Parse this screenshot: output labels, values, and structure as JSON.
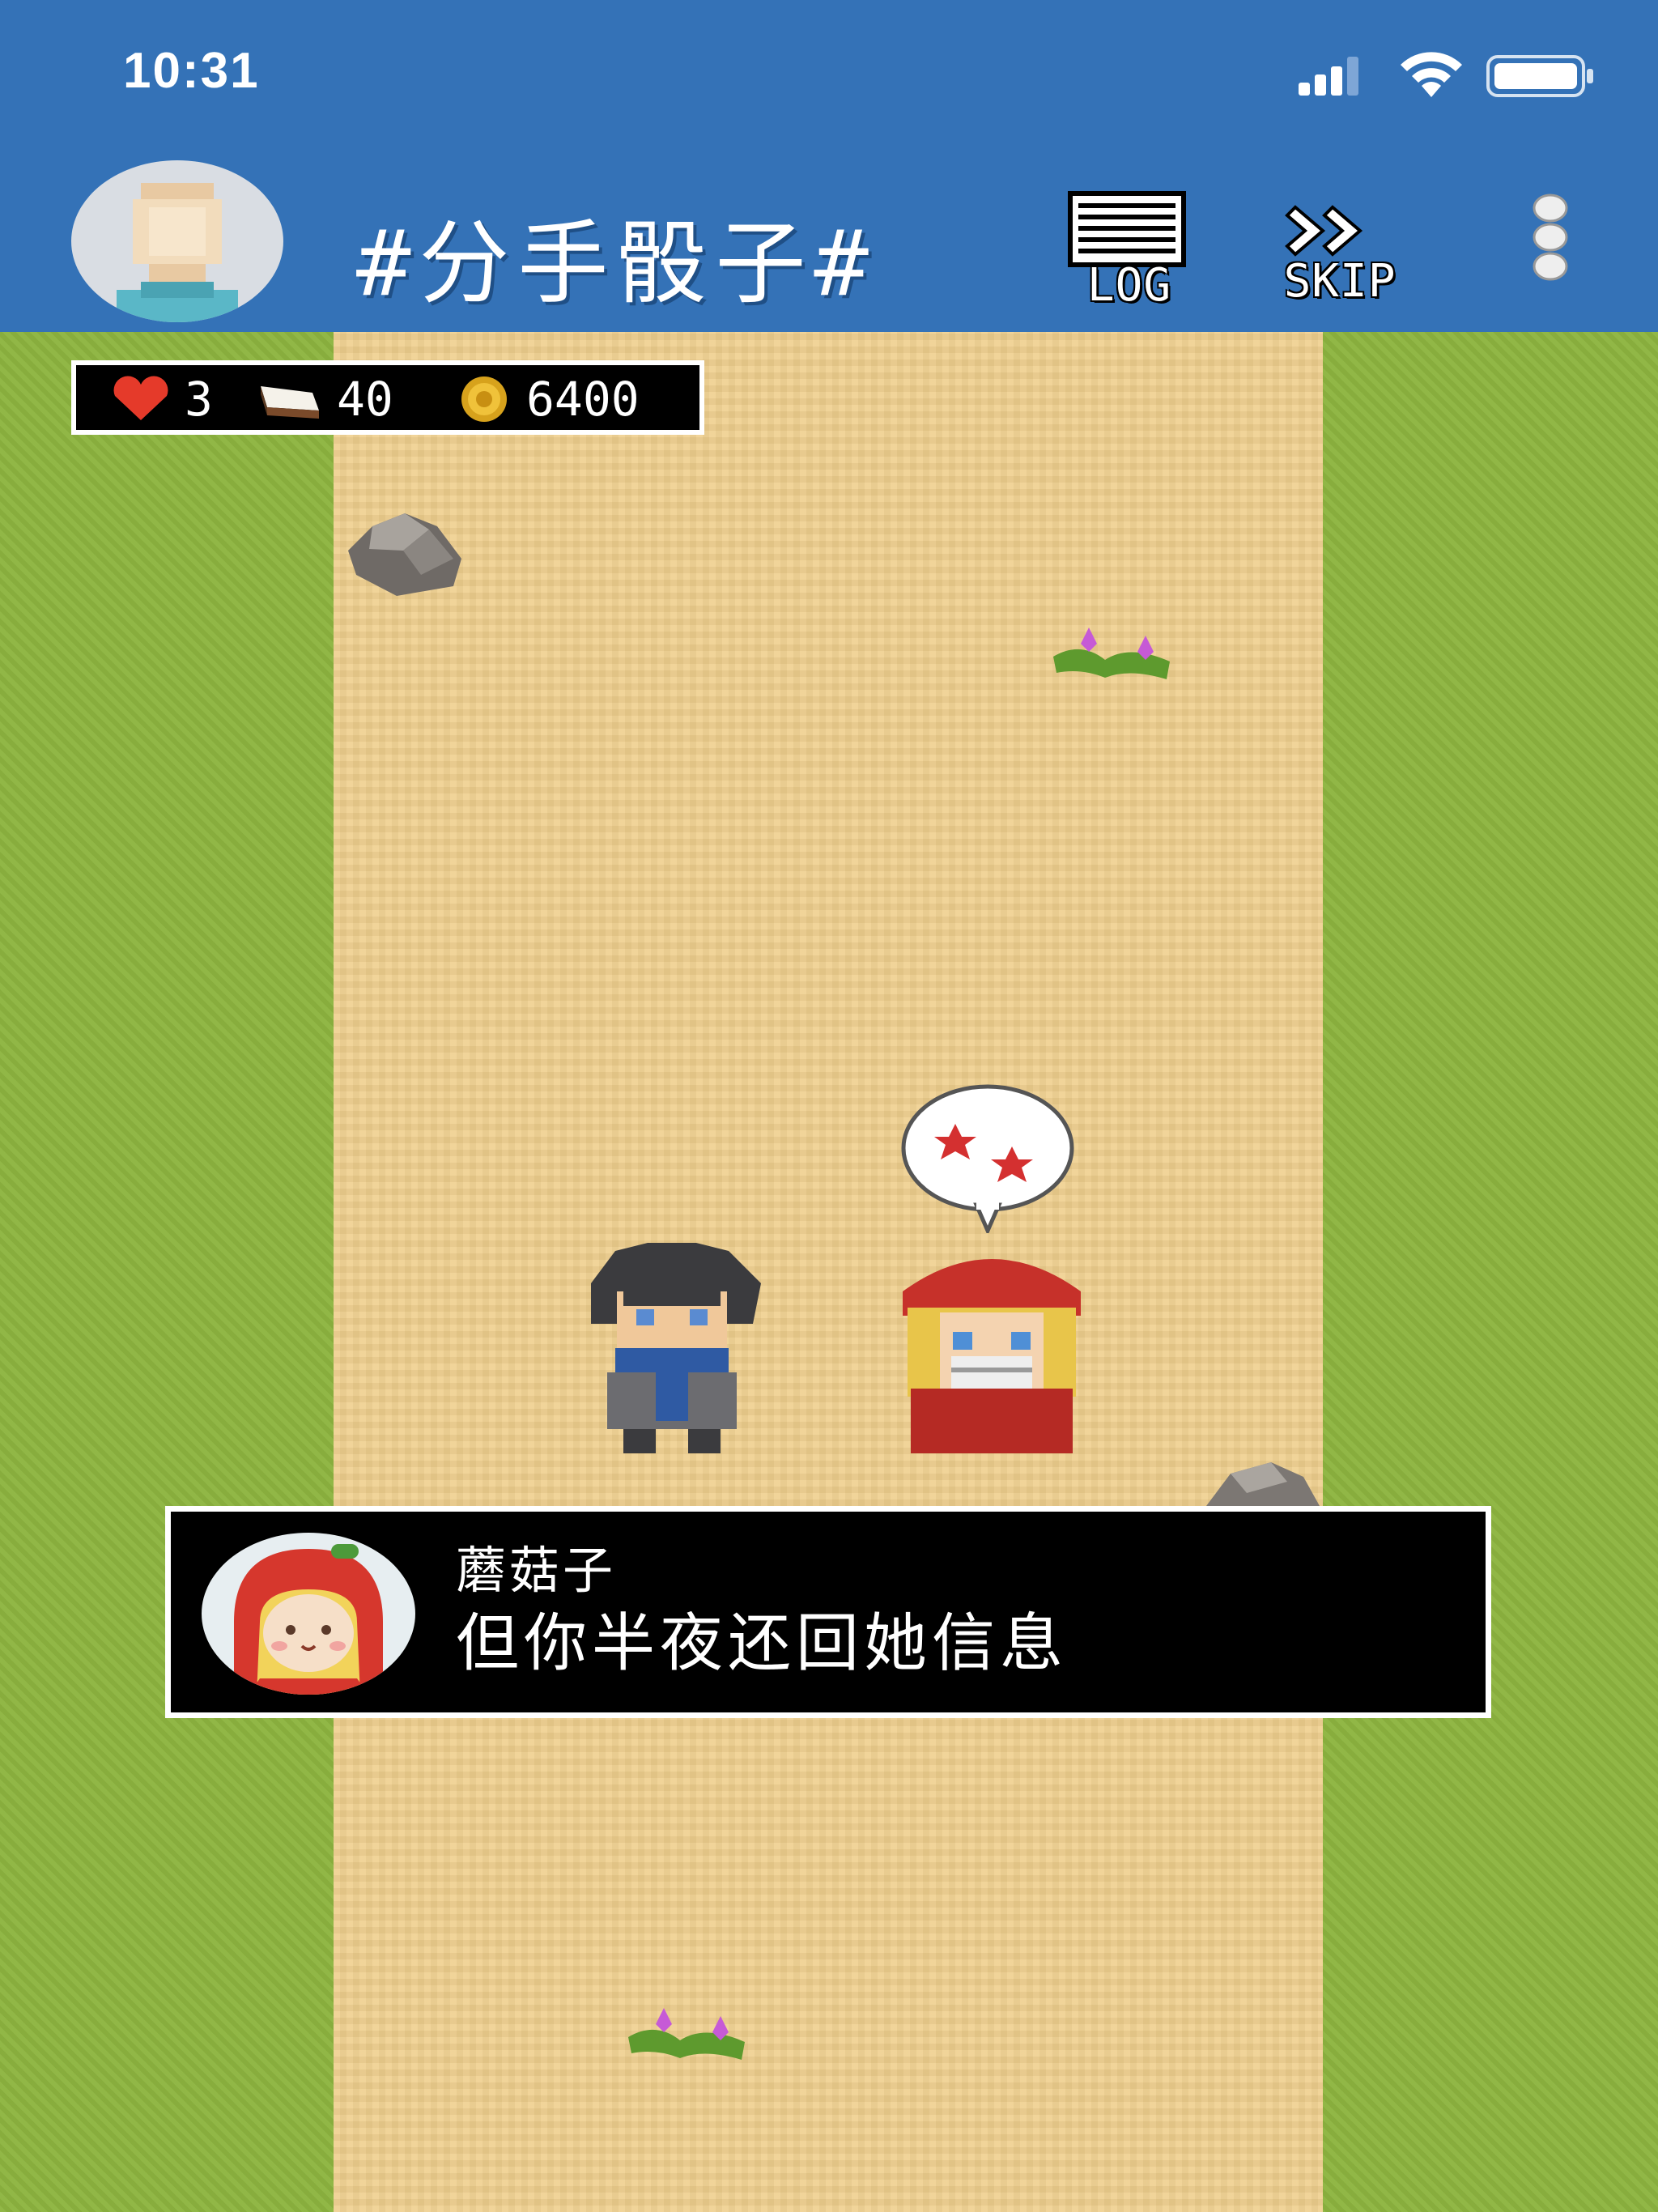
{
  "status_bar": {
    "time": "10:31"
  },
  "header": {
    "title": "#分手骰子#",
    "log_label": "LOG",
    "skip_label": "SKIP"
  },
  "hud": {
    "lives": "3",
    "tickets": "40",
    "coins": "6400"
  },
  "dialog": {
    "speaker": "蘑菇子",
    "text": "但你半夜还回她信息"
  },
  "colors": {
    "header_bg": "#3472b7",
    "grass": "#8db43f",
    "sand": "#efcf8d",
    "dialog_bg": "#000000"
  },
  "icons": [
    "heart-icon",
    "ticket-icon",
    "coin-icon",
    "log-icon",
    "skip-icon",
    "more-icon",
    "signal-icon",
    "wifi-icon",
    "battery-icon"
  ]
}
